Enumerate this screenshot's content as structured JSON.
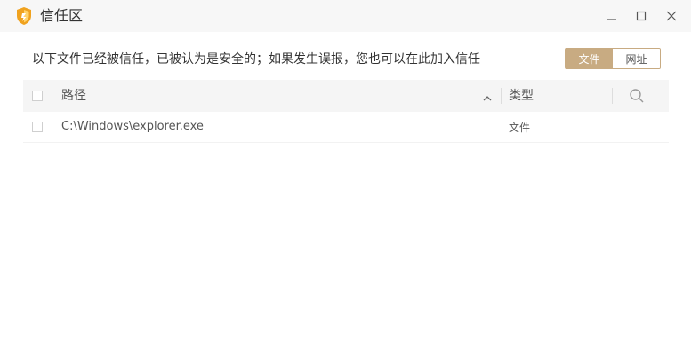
{
  "window": {
    "title": "信任区",
    "logo_icon": "shield-icon",
    "controls": {
      "minimize_icon": "minimize-icon",
      "maximize_icon": "maximize-icon",
      "close_icon": "close-icon"
    }
  },
  "description": "以下文件已经被信任，已被认为是安全的；如果发生误报，您也可以在此加入信任",
  "segment": {
    "options": [
      "文件",
      "网址"
    ],
    "selected": "文件"
  },
  "table": {
    "columns": {
      "path": "路径",
      "type": "类型"
    },
    "rows": [
      {
        "path": "C:\\Windows\\explorer.exe",
        "type": "文件"
      }
    ]
  },
  "colors": {
    "accent": "#c8ab82",
    "logo": "#f0a21e"
  }
}
